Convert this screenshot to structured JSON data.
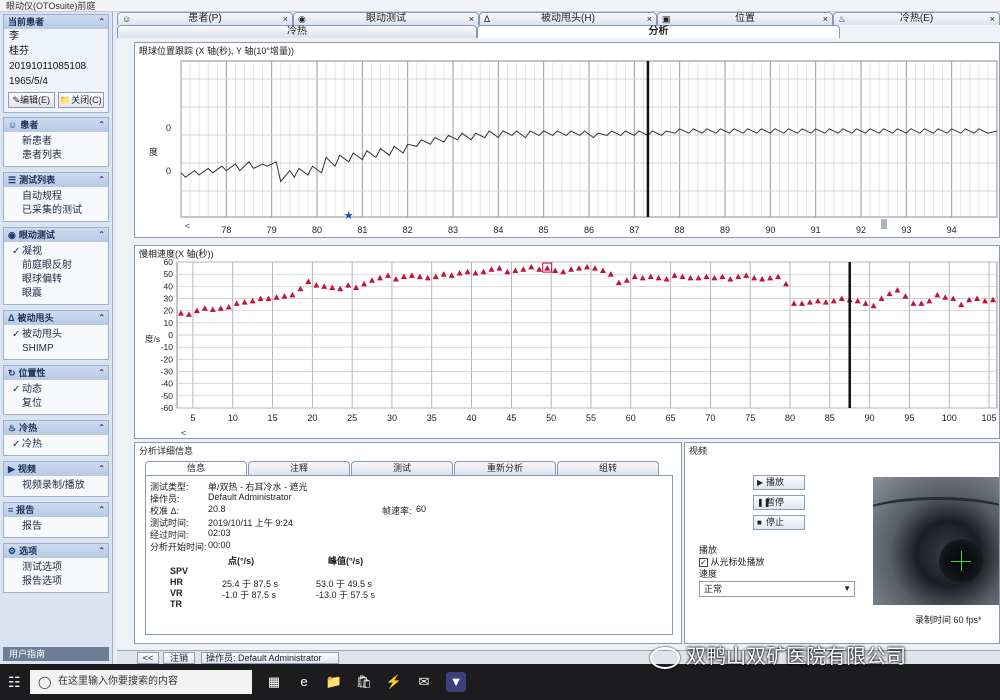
{
  "app": {
    "title": "眼动仪(OTOsuite)前庭"
  },
  "colors": {
    "accent": "#1c3a74",
    "spv_marker": "#c0143c",
    "trace": "#333333",
    "marker_star": "#2d3ec7",
    "crosshair": "#3cd74a"
  },
  "sidebar": {
    "patient_header": "当前患者",
    "patient_lines": [
      "李",
      "桂芬",
      "20191011085108",
      "1965/5/4"
    ],
    "edit_label": "编辑(E)",
    "close_label": "关闭(C)",
    "groups": [
      {
        "title": "患者",
        "icon": "person-icon",
        "items": [
          {
            "label": "新患者",
            "checked": false
          },
          {
            "label": "患者列表",
            "checked": false
          }
        ]
      },
      {
        "title": "测试列表",
        "icon": "list-icon",
        "items": [
          {
            "label": "自动规程",
            "checked": false
          },
          {
            "label": "已采集的测试",
            "checked": false
          }
        ]
      },
      {
        "title": "眼动测试",
        "icon": "eye-icon",
        "items": [
          {
            "label": "凝视",
            "checked": true
          },
          {
            "label": "前庭眼反射",
            "checked": false
          },
          {
            "label": "眼球偏转",
            "checked": false
          },
          {
            "label": "眼震",
            "checked": false
          }
        ]
      },
      {
        "title": "被动甩头",
        "icon": "head-icon",
        "items": [
          {
            "label": "被动甩头",
            "checked": true
          },
          {
            "label": "SHIMP",
            "checked": false
          }
        ]
      },
      {
        "title": "位置性",
        "icon": "position-icon",
        "items": [
          {
            "label": "动态",
            "checked": true
          },
          {
            "label": "复位",
            "checked": false
          }
        ]
      },
      {
        "title": "冷热",
        "icon": "thermo-icon",
        "items": [
          {
            "label": "冷热",
            "checked": true
          }
        ]
      },
      {
        "title": "视频",
        "icon": "video-icon",
        "items": [
          {
            "label": "视频录制/播放",
            "checked": false
          }
        ]
      },
      {
        "title": "报告",
        "icon": "report-icon",
        "items": [
          {
            "label": "报告",
            "checked": false
          }
        ]
      },
      {
        "title": "选项",
        "icon": "options-icon",
        "items": [
          {
            "label": "测试选项",
            "checked": false
          },
          {
            "label": "报告选项",
            "checked": false
          }
        ]
      }
    ],
    "bottom_label": "用户指南"
  },
  "tabs": {
    "top": [
      {
        "label": "患者(P)",
        "icon": "person-icon"
      },
      {
        "label": "眼动测试",
        "icon": "eye-icon"
      },
      {
        "label": "被动甩头(H)",
        "icon": "head-icon"
      },
      {
        "label": "位置",
        "icon": "car-icon"
      },
      {
        "label": "冷热(E)",
        "icon": "thermo-icon"
      }
    ],
    "sub": [
      {
        "label": "冷热",
        "active": false
      },
      {
        "label": "分析",
        "active": true
      }
    ]
  },
  "chart_data": [
    {
      "type": "line",
      "title": "眼球位置跟踪 (X 轴(秒), Y 轴(10°增量))",
      "ylabel": "度",
      "xlim": [
        77,
        95
      ],
      "xticks": [
        78,
        79,
        80,
        81,
        82,
        83,
        84,
        85,
        86,
        87,
        88,
        89,
        90,
        91,
        92,
        93,
        94
      ],
      "yticks": [
        0,
        0
      ],
      "cursor_x": 87.3,
      "marker_x": 80.7,
      "series": [
        {
          "x": [
            77.0,
            77.1,
            77.3,
            77.4,
            77.6,
            77.7,
            77.9,
            78.0,
            78.2,
            78.3,
            78.5,
            78.6,
            78.8,
            78.9,
            79.1,
            79.2,
            79.4,
            79.5,
            79.6,
            79.8,
            79.9,
            80.1,
            80.2,
            80.4,
            80.5,
            80.7,
            80.8,
            81.0,
            81.1,
            81.3,
            81.4,
            81.6,
            81.7,
            81.9,
            82.0,
            82.2,
            82.3,
            82.5,
            82.6,
            82.8,
            82.9,
            83.1,
            83.2,
            83.4,
            83.5,
            83.7,
            83.8,
            84.0,
            84.1,
            84.3,
            84.4,
            84.6,
            84.7,
            84.9,
            85.0,
            85.2,
            85.3,
            85.5,
            85.6,
            85.8,
            85.9,
            86.1,
            86.2,
            86.4,
            86.5,
            86.7,
            86.8,
            87.0,
            87.1,
            87.3,
            87.4,
            87.6,
            87.7,
            87.9,
            88.0,
            88.2,
            88.3,
            88.5,
            88.6,
            88.8,
            88.9,
            89.1,
            89.2,
            89.4,
            89.5,
            89.7,
            89.8,
            90.0,
            90.1,
            90.3,
            90.4,
            90.6,
            90.7,
            90.9,
            91.0,
            91.2,
            91.3,
            91.5,
            91.6,
            91.8,
            91.9,
            92.1,
            92.2,
            92.4,
            92.5,
            92.7,
            92.8,
            93.0,
            93.1,
            93.3,
            93.4,
            93.6,
            93.7,
            93.9,
            94.0,
            94.2,
            94.3,
            94.5,
            94.6,
            94.8,
            95.0
          ],
          "y": [
            -0.9,
            -1.1,
            -0.8,
            -1.0,
            -0.7,
            -0.9,
            -0.6,
            -0.8,
            -0.5,
            -0.8,
            -0.4,
            -0.7,
            -0.5,
            -0.6,
            -0.4,
            -1.3,
            -0.8,
            -1.1,
            -0.7,
            -1.0,
            -0.6,
            -0.9,
            -0.2,
            -0.6,
            -0.1,
            -0.4,
            0.0,
            -0.3,
            0.1,
            -0.2,
            0.2,
            -0.1,
            0.3,
            0.0,
            0.4,
            0.3,
            0.6,
            0.4,
            0.7,
            0.5,
            0.8,
            0.6,
            0.9,
            0.6,
            0.9,
            0.7,
            1.0,
            0.7,
            1.0,
            0.8,
            1.0,
            0.7,
            1.0,
            0.8,
            1.0,
            0.8,
            1.0,
            0.8,
            1.0,
            0.8,
            1.0,
            0.7,
            0.9,
            0.8,
            1.0,
            0.8,
            1.0,
            0.8,
            1.0,
            0.8,
            1.0,
            0.8,
            1.0,
            0.9,
            1.1,
            0.9,
            1.1,
            0.9,
            1.1,
            0.9,
            1.1,
            0.9,
            1.1,
            0.9,
            1.1,
            0.9,
            1.1,
            0.9,
            1.1,
            0.9,
            1.1,
            0.9,
            1.1,
            0.9,
            1.1,
            0.9,
            1.1,
            0.9,
            1.1,
            0.9,
            1.1,
            0.9,
            1.1,
            0.9,
            1.1,
            0.9,
            1.1,
            0.9,
            1.1,
            0.9,
            1.1,
            0.9,
            1.1,
            0.9,
            1.1,
            0.9,
            1.1,
            0.9,
            1.1,
            0.9,
            1.0
          ]
        }
      ]
    },
    {
      "type": "scatter",
      "title": "慢相速度(X 轴(秒))",
      "ylabel": "度/s",
      "xlim": [
        3,
        106
      ],
      "ylim": [
        -60,
        60
      ],
      "xticks": [
        5,
        10,
        15,
        20,
        25,
        30,
        35,
        40,
        45,
        50,
        55,
        60,
        65,
        70,
        75,
        80,
        85,
        90,
        95,
        100,
        105
      ],
      "yticks": [
        60,
        50,
        40,
        30,
        20,
        10,
        0,
        -10,
        -20,
        -30,
        -40,
        -50,
        -60
      ],
      "cursor_x": 87.5,
      "peak_marker_x": 49.5,
      "series": [
        {
          "x": [
            3.5,
            4.5,
            5.5,
            6.5,
            7.5,
            8.5,
            9.5,
            10.5,
            11.5,
            12.5,
            13.5,
            14.5,
            15.5,
            16.5,
            17.5,
            18.5,
            19.5,
            20.5,
            21.5,
            22.5,
            23.5,
            24.5,
            25.5,
            26.5,
            27.5,
            28.5,
            29.5,
            30.5,
            31.5,
            32.5,
            33.5,
            34.5,
            35.5,
            36.5,
            37.5,
            38.5,
            39.5,
            40.5,
            41.5,
            42.5,
            43.5,
            44.5,
            45.5,
            46.5,
            47.5,
            48.5,
            49.5,
            50.5,
            51.5,
            52.5,
            53.5,
            54.5,
            55.5,
            56.5,
            57.5,
            58.5,
            59.5,
            60.5,
            61.5,
            62.5,
            63.5,
            64.5,
            65.5,
            66.5,
            67.5,
            68.5,
            69.5,
            70.5,
            71.5,
            72.5,
            73.5,
            74.5,
            75.5,
            76.5,
            77.5,
            78.5,
            79.5,
            80.5,
            81.5,
            82.5,
            83.5,
            84.5,
            85.5,
            86.5,
            87.5,
            88.5,
            89.5,
            90.5,
            91.5,
            92.5,
            93.5,
            94.5,
            95.5,
            96.5,
            97.5,
            98.5,
            99.5,
            100.5,
            101.5,
            102.5,
            103.5,
            104.5,
            105.5
          ],
          "y": [
            18,
            17,
            20,
            22,
            21,
            22,
            23,
            26,
            27,
            28,
            30,
            30,
            31,
            32,
            33,
            38,
            44,
            41,
            40,
            39,
            38,
            41,
            39,
            42,
            45,
            47,
            49,
            46,
            48,
            49,
            48,
            47,
            48,
            50,
            49,
            51,
            52,
            51,
            52,
            54,
            55,
            52,
            53,
            54,
            56,
            54,
            55,
            53,
            52,
            54,
            55,
            56,
            55,
            53,
            50,
            43,
            45,
            48,
            47,
            48,
            47,
            46,
            49,
            48,
            47,
            47,
            48,
            47,
            48,
            46,
            48,
            49,
            47,
            46,
            47,
            48,
            42,
            26,
            26,
            27,
            28,
            27,
            28,
            30,
            29,
            28,
            26,
            24,
            30,
            34,
            37,
            32,
            26,
            26,
            28,
            33,
            31,
            30,
            25,
            29,
            30,
            28,
            29
          ]
        }
      ]
    }
  ],
  "detail": {
    "title": "分析详细信息",
    "tabs": [
      "信息",
      "注释",
      "测试",
      "重新分析",
      "组转"
    ],
    "info": {
      "test_type_label": "测试类型:",
      "test_type_value": "单/双热 - 右耳冷水 - 遮光",
      "operator_label": "操作员:",
      "operator_value": "Default Administrator",
      "calib_label": "校准 Δ:",
      "calib_value": "20.8",
      "framerate_label": "帧速率:",
      "framerate_value": "60",
      "test_time_label": "测试时间:",
      "test_time_value": "2019/10/11 上午 9:24",
      "elapsed_label": "经过时间:",
      "elapsed_value": "02:03",
      "analysis_start_label": "分析开始时间:",
      "analysis_start_value": "00:00"
    },
    "table": {
      "col_point": "点(°/s)",
      "col_peak": "峰值(°/s)",
      "rows": [
        {
          "name": "SPV",
          "point": "",
          "peak": ""
        },
        {
          "name": "HR",
          "point": "25.4 于 87.5 s",
          "peak": "53.0 于 49.5 s"
        },
        {
          "name": "VR",
          "point": "-1.0 于 87.5 s",
          "peak": "-13.0 于 57.5 s"
        },
        {
          "name": "TR",
          "point": "",
          "peak": ""
        }
      ]
    }
  },
  "video": {
    "title": "视频",
    "play_label": "播放",
    "pause_label": "暂停",
    "stop_label": "停止",
    "playback_label": "播放",
    "from_cursor_label": "从光标处播放",
    "from_cursor_checked": true,
    "speed_label": "速度",
    "speed_value": "正常",
    "record_time_label": "录制时间 60 fps*"
  },
  "statusbar": {
    "back_label": "<<",
    "cancel_label": "注销",
    "operator_text": "操作员: Default Administrator"
  },
  "taskbar": {
    "search_placeholder": "在这里输入你要搜索的内容"
  },
  "watermark": {
    "text": "双鸭山双矿医院有限公司"
  }
}
